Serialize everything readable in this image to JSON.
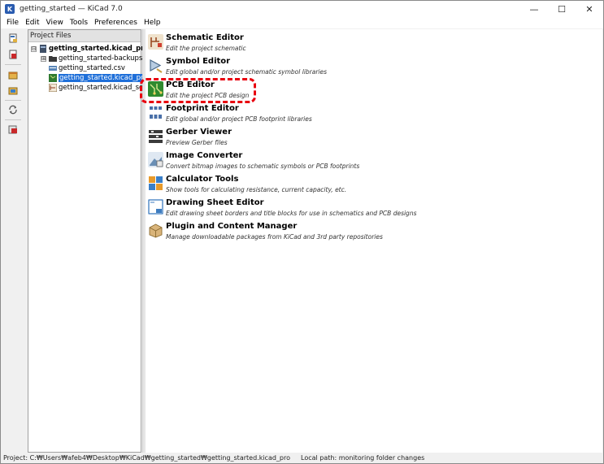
{
  "window": {
    "title": "getting_started — KiCad 7.0",
    "app_icon": "K",
    "controls": {
      "minimize": "—",
      "maximize": "☐",
      "close": "✕"
    }
  },
  "menu": [
    "File",
    "Edit",
    "View",
    "Tools",
    "Preferences",
    "Help"
  ],
  "left_toolbar": {
    "icons": [
      "new-project-icon",
      "open-project-icon",
      "archive-icon",
      "unarchive-icon",
      "refresh-icon",
      "open-dir-icon"
    ]
  },
  "project_panel": {
    "header": "Project Files",
    "tree": [
      {
        "label": "getting_started.kicad_pro",
        "bold": true,
        "expander": "⊟",
        "icon": "project-file-icon",
        "level": 0
      },
      {
        "label": "getting_started-backups",
        "expander": "⊞",
        "icon": "folder-icon",
        "level": 1
      },
      {
        "label": "getting_started.csv",
        "icon": "csv-file-icon",
        "level": 1
      },
      {
        "label": "getting_started.kicad_pcb",
        "selected": true,
        "icon": "pcb-file-icon",
        "level": 1
      },
      {
        "label": "getting_started.kicad_sch",
        "icon": "schematic-file-icon",
        "level": 1
      }
    ]
  },
  "tools": [
    {
      "name": "Schematic Editor",
      "desc": "Edit the project schematic",
      "icon": "schematic-editor-icon",
      "color": "#c9a37a"
    },
    {
      "name": "Symbol Editor",
      "desc": "Edit global and/or project schematic symbol libraries",
      "icon": "symbol-editor-icon",
      "color": "#8fb0cf"
    },
    {
      "name": "PCB Editor",
      "desc": "Edit the project PCB design",
      "icon": "pcb-editor-icon",
      "color": "#2f8a2f"
    },
    {
      "name": "Footprint Editor",
      "desc": "Edit global and/or project PCB footprint libraries",
      "icon": "footprint-editor-icon",
      "color": "#5b7fb3"
    },
    {
      "name": "Gerber Viewer",
      "desc": "Preview Gerber files",
      "icon": "gerber-viewer-icon",
      "color": "#3a3a3a"
    },
    {
      "name": "Image Converter",
      "desc": "Convert bitmap images to schematic symbols or PCB footprints",
      "icon": "image-converter-icon",
      "color": "#6a8fb5"
    },
    {
      "name": "Calculator Tools",
      "desc": "Show tools for calculating resistance, current capacity, etc.",
      "icon": "calculator-icon",
      "color": "#e89a2a"
    },
    {
      "name": "Drawing Sheet Editor",
      "desc": "Edit drawing sheet borders and title blocks for use in schematics and PCB designs",
      "icon": "drawing-sheet-icon",
      "color": "#3d7cc0"
    },
    {
      "name": "Plugin and Content Manager",
      "desc": "Manage downloadable packages from KiCad and 3rd party repositories",
      "icon": "plugin-manager-icon",
      "color": "#c49a5c"
    }
  ],
  "status": {
    "left": "Project: C:₩Users₩afeb4₩Desktop₩KiCad₩getting_started₩getting_started.kicad_pro",
    "right": "Local path: monitoring folder changes"
  },
  "colors": {
    "highlight": "#e8000e",
    "selection": "#1e6fd9"
  }
}
